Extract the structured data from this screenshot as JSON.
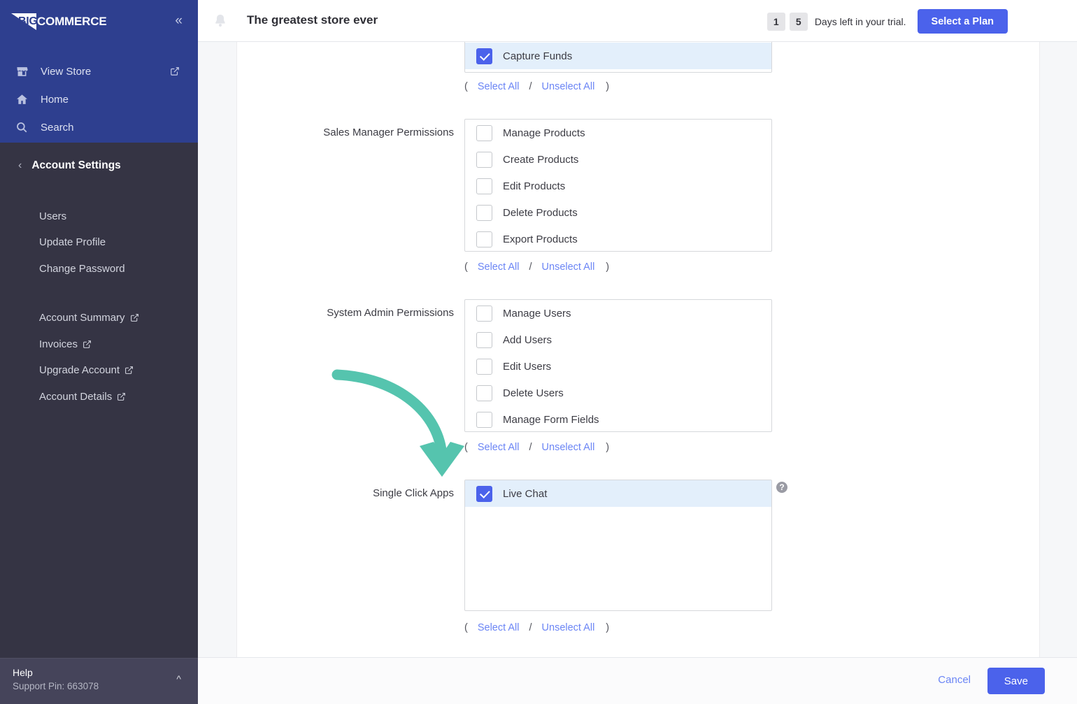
{
  "sidebar": {
    "logo": {
      "mark": "BIG",
      "word": "COMMERCE"
    },
    "collapse_icon": "chevron-double-left-icon",
    "nav": [
      {
        "label": "View Store",
        "icon": "store-icon",
        "external": true
      },
      {
        "label": "Home",
        "icon": "home-icon",
        "external": false
      },
      {
        "label": "Search",
        "icon": "search-icon",
        "external": false
      }
    ],
    "section": {
      "title": "Account Settings",
      "back_icon": "chevron-left-icon"
    },
    "links": [
      {
        "label": "Users",
        "external": false
      },
      {
        "label": "Update Profile",
        "external": false
      },
      {
        "label": "Change Password",
        "external": false
      },
      {
        "label": "Account Summary",
        "external": true
      },
      {
        "label": "Invoices",
        "external": true
      },
      {
        "label": "Upgrade Account",
        "external": true
      },
      {
        "label": "Account Details",
        "external": true
      }
    ],
    "help": {
      "title": "Help",
      "support_pin": "Support Pin: 663078",
      "chevron": "chevron-up-icon"
    }
  },
  "header": {
    "bell_icon": "notification-bell-icon",
    "store_title": "The greatest store ever",
    "trial_days_digits": [
      "1",
      "5"
    ],
    "trial_text": "Days left in your trial.",
    "select_plan_label": "Select a Plan"
  },
  "form": {
    "groups": [
      {
        "label": "",
        "options": [
          {
            "label": "Capture Funds",
            "checked": true
          }
        ],
        "links": {
          "open": "(",
          "select_all": "Select All",
          "divider": "/",
          "unselect_all": "Unselect All",
          "close": ")"
        }
      },
      {
        "label": "Sales Manager Permissions",
        "options": [
          {
            "label": "Manage Products",
            "checked": false
          },
          {
            "label": "Create Products",
            "checked": false
          },
          {
            "label": "Edit Products",
            "checked": false
          },
          {
            "label": "Delete Products",
            "checked": false
          },
          {
            "label": "Export Products",
            "checked": false
          }
        ],
        "links": {
          "open": "(",
          "select_all": "Select All",
          "divider": "/",
          "unselect_all": "Unselect All",
          "close": ")"
        }
      },
      {
        "label": "System Admin Permissions",
        "options": [
          {
            "label": "Manage Users",
            "checked": false
          },
          {
            "label": "Add Users",
            "checked": false
          },
          {
            "label": "Edit Users",
            "checked": false
          },
          {
            "label": "Delete Users",
            "checked": false
          },
          {
            "label": "Manage Form Fields",
            "checked": false
          }
        ],
        "links": {
          "open": "(",
          "select_all": "Select All",
          "divider": "/",
          "unselect_all": "Unselect All",
          "close": ")"
        }
      },
      {
        "label": "Single Click Apps",
        "help_icon": "help-question-icon",
        "options": [
          {
            "label": "Live Chat",
            "checked": true
          }
        ],
        "links": {
          "open": "(",
          "select_all": "Select All",
          "divider": "/",
          "unselect_all": "Unselect All",
          "close": ")"
        }
      }
    ]
  },
  "footer": {
    "cancel_label": "Cancel",
    "save_label": "Save"
  },
  "annotation": {
    "type": "curved-arrow",
    "color": "#55c4ae",
    "points_to": "Live Chat checkbox"
  },
  "colors": {
    "brand_navy": "#2e3f8f",
    "sidebar_dark": "#353444",
    "accent_blue": "#4b62eb",
    "link_blue": "#6b85f5",
    "row_selected": "#e3effb",
    "annotation_teal": "#55c4ae"
  }
}
